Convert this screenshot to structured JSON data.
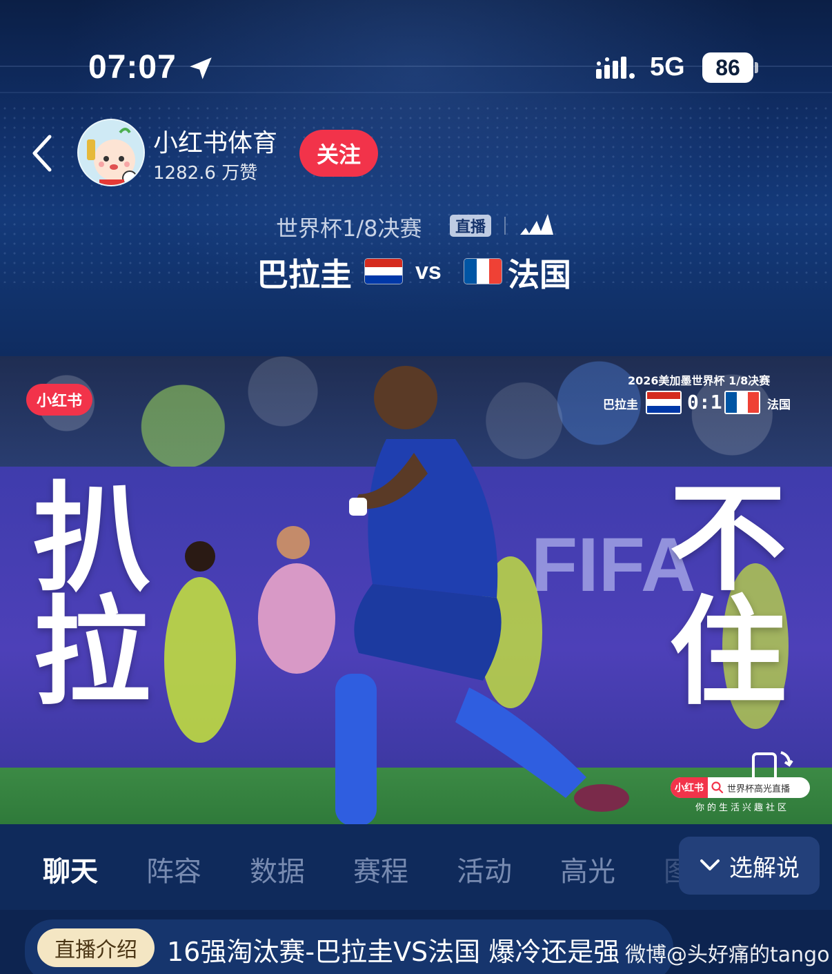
{
  "status_bar": {
    "time": "07:07",
    "network": "5G",
    "battery": "86"
  },
  "account": {
    "name": "小红书体育",
    "likes": "1282.6 万赞",
    "follow_label": "关注"
  },
  "match": {
    "stage": "世界杯1/8决赛",
    "live_label": "直播",
    "home_team": "巴拉圭",
    "vs_label": "vs",
    "away_team": "法国"
  },
  "banner": {
    "brand_badge": "小红书",
    "scoreboard_title": "2026美加墨世界杯  1/8决赛",
    "score_home": "巴拉圭",
    "score": "0:1",
    "score_away": "法国",
    "headline_left": [
      "扒",
      "拉"
    ],
    "headline_right": [
      "不",
      "住"
    ],
    "board_text": "FIFA",
    "search_brand": "小红书",
    "search_text": "世界杯高光直播",
    "slogan": "你的生活兴趣社区"
  },
  "tabs": [
    {
      "label": "聊天",
      "active": true
    },
    {
      "label": "阵容",
      "active": false
    },
    {
      "label": "数据",
      "active": false
    },
    {
      "label": "赛程",
      "active": false
    },
    {
      "label": "活动",
      "active": false
    },
    {
      "label": "高光",
      "active": false
    },
    {
      "label": "图",
      "active": false
    }
  ],
  "commentary_label": "选解说",
  "intro": {
    "badge": "直播介绍",
    "text": "16强淘汰赛-巴拉圭VS法国 爆冷还是强"
  },
  "watermark": "微博@头好痛的tango",
  "colors": {
    "brand_red": "#f2334a",
    "background": "#0d2450",
    "paraguay_red": "#d52b1e",
    "paraguay_blue": "#0038a8",
    "france_blue": "#0055a4",
    "france_red": "#ef4135"
  }
}
